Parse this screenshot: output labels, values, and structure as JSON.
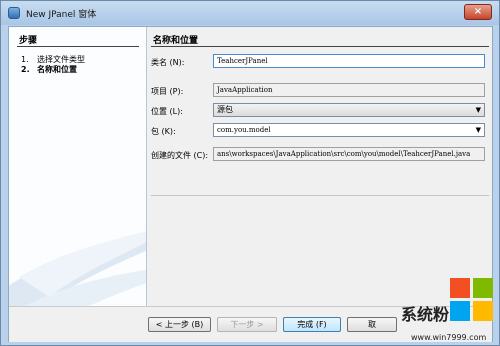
{
  "window": {
    "title": "New JPanel 窗体",
    "close_label": "×"
  },
  "steps": {
    "heading": "步骤",
    "items": [
      {
        "num": "1.",
        "label": "选择文件类型"
      },
      {
        "num": "2.",
        "label": "名称和位置"
      }
    ]
  },
  "form": {
    "heading": "名称和位置",
    "class_name_label": "类名 (N):",
    "class_name_value": "TeahcerJPanel",
    "project_label": "项目 (P):",
    "project_value": "JavaApplication",
    "location_label": "位置 (L):",
    "location_value": "源包",
    "package_label": "包 (K):",
    "package_value": "com.you.model",
    "created_file_label": "创建的文件 (C):",
    "created_file_value": "ans\\workspaces\\JavaApplication\\src\\com\\you\\model\\TeahcerJPanel.java"
  },
  "buttons": {
    "back": "< 上一步 (B)",
    "next": "下一步 >",
    "finish": "完成 (F)",
    "cancel": "取"
  },
  "watermark": {
    "brand": "系统粉",
    "url": "www.win7999.com"
  },
  "colors": {
    "logo_red": "#f25022",
    "logo_green": "#7fba00",
    "logo_blue": "#00a4ef",
    "logo_yellow": "#ffb900"
  }
}
